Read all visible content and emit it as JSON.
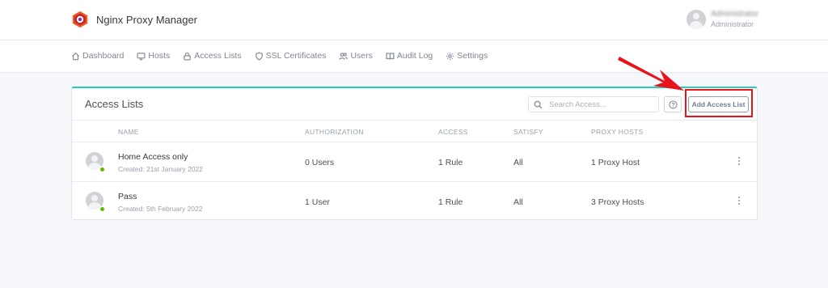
{
  "app": {
    "title": "Nginx Proxy Manager"
  },
  "user": {
    "name": "Administrator",
    "role": "Administrator"
  },
  "nav": [
    {
      "label": "Dashboard",
      "icon": "home-icon"
    },
    {
      "label": "Hosts",
      "icon": "monitor-icon"
    },
    {
      "label": "Access Lists",
      "icon": "lock-icon"
    },
    {
      "label": "SSL Certificates",
      "icon": "shield-icon"
    },
    {
      "label": "Users",
      "icon": "users-icon"
    },
    {
      "label": "Audit Log",
      "icon": "book-icon"
    },
    {
      "label": "Settings",
      "icon": "gear-icon"
    }
  ],
  "card": {
    "title": "Access Lists",
    "search_placeholder": "Search Access...",
    "add_label": "Add Access List",
    "accent_color": "#2bcbba"
  },
  "table": {
    "columns": [
      "NAME",
      "AUTHORIZATION",
      "ACCESS",
      "SATISFY",
      "PROXY HOSTS"
    ],
    "rows": [
      {
        "name": "Home Access only",
        "created": "Created: 21st January 2022",
        "authorization": "0 Users",
        "access": "1 Rule",
        "satisfy": "All",
        "proxy_hosts": "1 Proxy Host"
      },
      {
        "name": "Pass",
        "created": "Created: 5th February 2022",
        "authorization": "1 User",
        "access": "1 Rule",
        "satisfy": "All",
        "proxy_hosts": "3 Proxy Hosts"
      }
    ]
  },
  "annotation": {
    "color": "#e8141c"
  }
}
